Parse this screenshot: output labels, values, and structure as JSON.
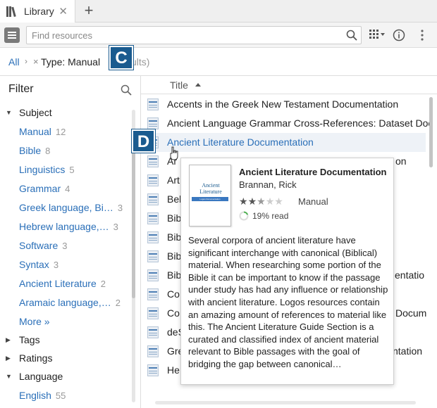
{
  "tab": {
    "label": "Library",
    "close_icon": "close-icon",
    "new_tab_label": "+"
  },
  "toolbar": {
    "search_placeholder": "Find resources",
    "icons": [
      "menu-icon",
      "search-icon",
      "view-options-icon",
      "info-icon",
      "more-vertical-icon"
    ]
  },
  "breadcrumb": {
    "all": "All",
    "separator": "›",
    "remove": "×",
    "filter": "Type: Manual",
    "results": "ults)"
  },
  "callouts": {
    "c": "C",
    "d": "D",
    "color": "#1a5b8f"
  },
  "filter": {
    "title": "Filter",
    "groups": [
      {
        "label": "Subject",
        "expanded": true
      },
      {
        "label": "Tags",
        "expanded": false
      },
      {
        "label": "Ratings",
        "expanded": false
      },
      {
        "label": "Language",
        "expanded": true
      }
    ],
    "subject_items": [
      {
        "label": "Manual",
        "count": "12"
      },
      {
        "label": "Bible",
        "count": "8"
      },
      {
        "label": "Linguistics",
        "count": "5"
      },
      {
        "label": "Grammar",
        "count": "4"
      },
      {
        "label": "Greek language, Bi…",
        "count": "3"
      },
      {
        "label": "Hebrew language,…",
        "count": "3"
      },
      {
        "label": "Software",
        "count": "3"
      },
      {
        "label": "Syntax",
        "count": "3"
      },
      {
        "label": "Ancient Literature",
        "count": "2"
      },
      {
        "label": "Aramaic language,…",
        "count": "2"
      }
    ],
    "more": "More »",
    "language_items": [
      {
        "label": "English",
        "count": "55"
      }
    ]
  },
  "results": {
    "column_title": "Title",
    "rows": [
      "Accents in the Greek New Testament Documentation",
      "Ancient Language Grammar Cross-References: Dataset Doc",
      "Ancient Literature Documentation",
      "Ar",
      "Art",
      "Bel",
      "Bib",
      "Bib",
      "Bib",
      "Bib",
      "Co",
      "Co",
      "deS",
      "Gre",
      "He"
    ],
    "row_tails": {
      "3": "on",
      "9": "entatio",
      "11": "Docum",
      "13": "ntation"
    }
  },
  "tooltip": {
    "cover_title": "Ancient Literature",
    "cover_subtitle": "Logos Documentation",
    "title": "Ancient Literature Documentation",
    "author": "Brannan, Rick",
    "rating": 2.5,
    "rating_max": 5,
    "type": "Manual",
    "read": "19% read",
    "read_fraction": 0.19,
    "description": "Several corpora of ancient literature have significant interchange with canonical (Biblical) material. When researching some portion of the Bible it can be important to know if the passage under study has had any influence or relationship with ancient literature. Logos resources contain an amazing amount of references to material like this. The Ancient Literature Guide Section is a curated and classified index of ancient material relevant to Bible passages with the goal of bridging the gap between canonical…"
  }
}
